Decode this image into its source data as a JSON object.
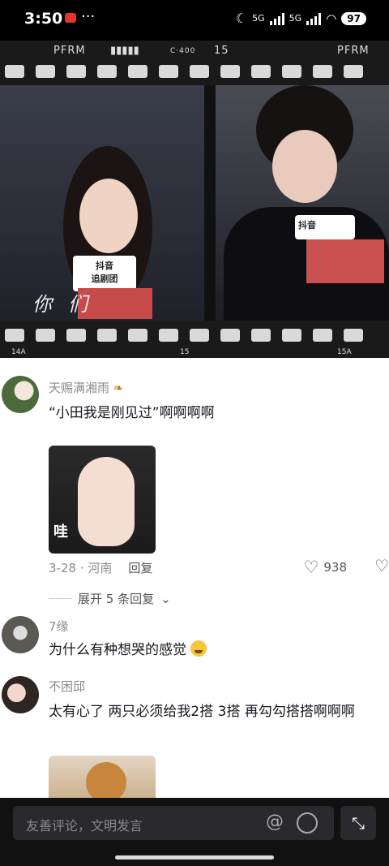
{
  "status_bar": {
    "time": "3:50",
    "more": "···",
    "network1": "5G",
    "network2": "5G",
    "battery": "97"
  },
  "video": {
    "film_label_left": "PFRM",
    "film_label_center": "C·400",
    "film_label_num": "15",
    "film_label_right": "PFRM",
    "frame_bottom_left": "14A",
    "frame_bottom_center": "15",
    "frame_bottom_right": "15A",
    "mic_left": "抖音\n追剧团",
    "mic_right": "抖音",
    "caption": "你们"
  },
  "comments": [
    {
      "username": "天赐满湘雨",
      "text": "“小田我是刚见过”啊啊啊啊",
      "image_text": "哇",
      "date_location": "3-28 · 河南",
      "reply_label": "回复",
      "like_count": "938",
      "expand_label": "展开 5 条回复"
    },
    {
      "username": "7缘",
      "text": "为什么有种想哭的感觉"
    },
    {
      "username": "不困邱",
      "text": "太有心了 两只必须给我2搭 3搭 再勾勾搭搭啊啊啊"
    }
  ],
  "input_bar": {
    "placeholder": "友善评论，文明发言",
    "at_icon": "@",
    "shrink_icon": "⤡"
  },
  "colors": {
    "status_bg": "#000000",
    "accent_red": "#e5352b",
    "comment_name": "#8a8a8e",
    "comment_text": "#161823",
    "input_bg": "#2a2a2e"
  }
}
